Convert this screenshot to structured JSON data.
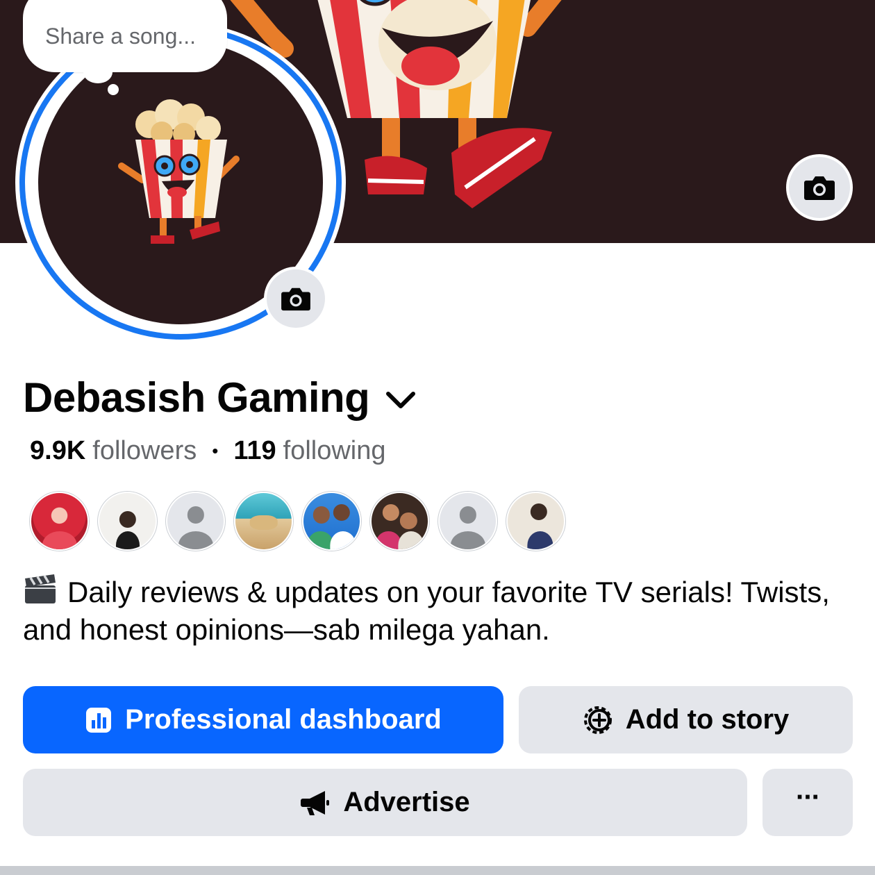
{
  "profile": {
    "name": "Debasish Gaming",
    "followers_count": "9.9K",
    "followers_label": "followers",
    "following_count": "119",
    "following_label": "following",
    "separator": "•"
  },
  "note_bubble": {
    "placeholder": "Share a song..."
  },
  "bio": {
    "emoji_icon": "clapper-board-icon",
    "text": "Daily reviews & updates on your favorite TV serials! Twists, and honest opinions—sab milega yahan."
  },
  "friends": [
    {
      "icon": "friend-avatar-photo"
    },
    {
      "icon": "friend-avatar-photo"
    },
    {
      "icon": "default-avatar-icon"
    },
    {
      "icon": "friend-avatar-photo"
    },
    {
      "icon": "friend-avatar-photo"
    },
    {
      "icon": "friend-avatar-photo"
    },
    {
      "icon": "default-avatar-icon"
    },
    {
      "icon": "friend-avatar-photo"
    }
  ],
  "actions": {
    "professional_dashboard": "Professional dashboard",
    "add_to_story": "Add to story",
    "advertise": "Advertise",
    "more": "···"
  },
  "colors": {
    "primary": "#0866ff",
    "ring": "#1877f2",
    "secondary_button": "#e4e6eb",
    "cover_bg": "#2a191b",
    "muted_text": "#65676b"
  }
}
